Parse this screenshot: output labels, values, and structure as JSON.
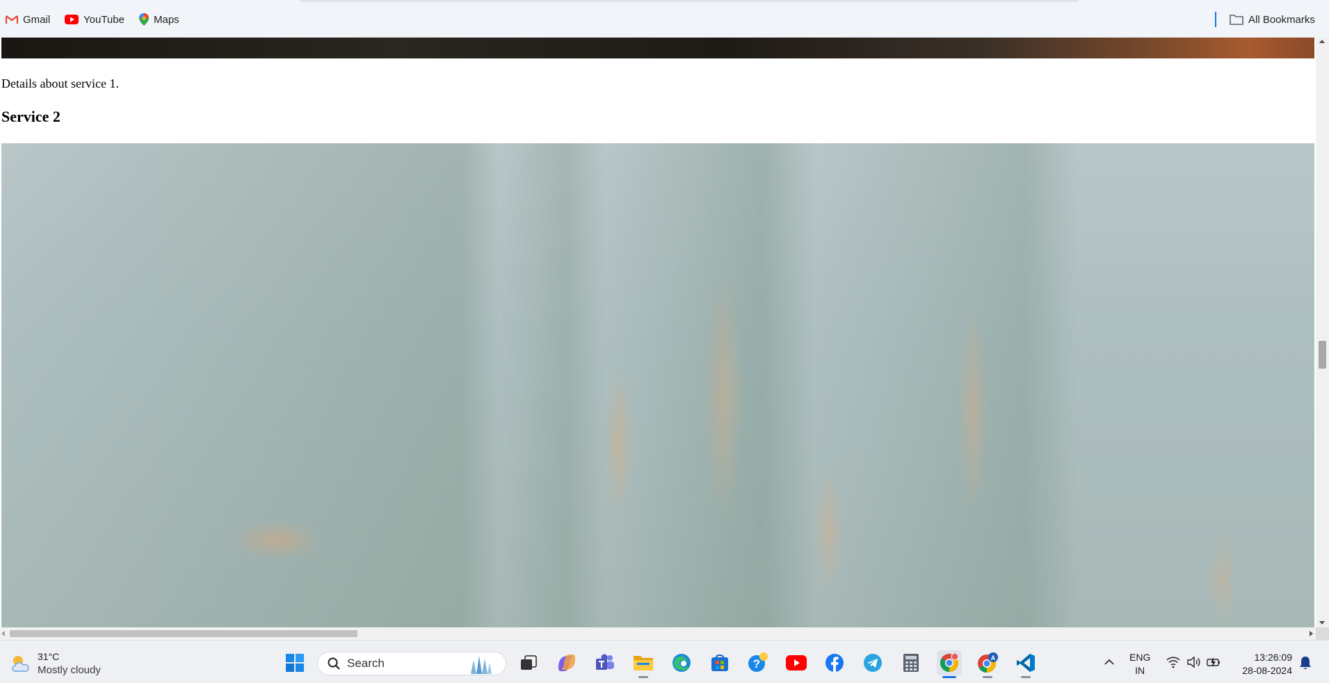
{
  "bookmarks": {
    "items": [
      {
        "label": "Gmail",
        "icon": "gmail-icon"
      },
      {
        "label": "YouTube",
        "icon": "youtube-icon"
      },
      {
        "label": "Maps",
        "icon": "maps-icon"
      }
    ],
    "all_bookmarks_label": "All Bookmarks"
  },
  "page": {
    "service1_details": "Details about service 1.",
    "service2_heading": "Service 2"
  },
  "taskbar": {
    "weather": {
      "temp": "31°C",
      "condition": "Mostly cloudy"
    },
    "search_placeholder": "Search",
    "apps": [
      "start",
      "search",
      "task-view",
      "copilot",
      "teams",
      "file-explorer",
      "edge",
      "store",
      "help",
      "youtube",
      "facebook",
      "telegram",
      "calculator",
      "chrome",
      "chrome-profile",
      "vscode"
    ],
    "language": {
      "line1": "ENG",
      "line2": "IN"
    },
    "clock": {
      "time": "13:26:09",
      "date": "28-08-2024"
    }
  }
}
